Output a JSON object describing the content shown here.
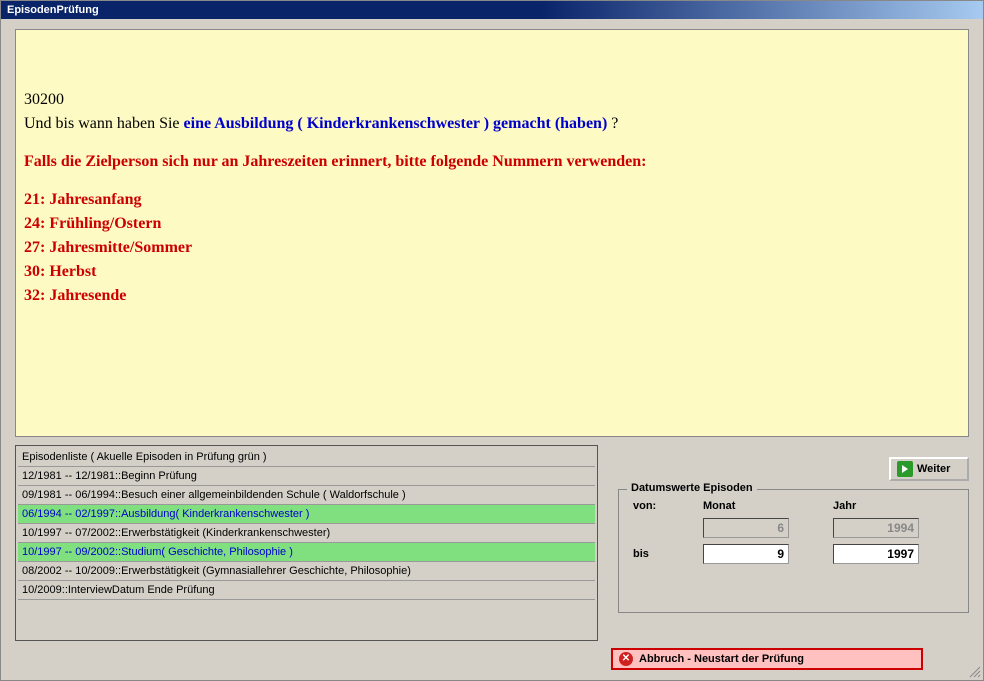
{
  "window": {
    "title": "EpisodenPrüfung"
  },
  "question": {
    "code": "30200",
    "prefix": "Und bis wann haben Sie ",
    "highlight": "eine Ausbildung ( Kinderkrankenschwester ) gemacht (haben)",
    "suffix": " ?"
  },
  "hint": {
    "intro": "Falls die Zielperson sich nur an Jahreszeiten erinnert, bitte folgende Nummern verwenden:",
    "lines": [
      "21: Jahresanfang",
      "24: Frühling/Ostern",
      "27: Jahresmitte/Sommer",
      "30: Herbst",
      "32: Jahresende"
    ]
  },
  "episodes": {
    "header": "Episodenliste ( Akuelle Episoden in Prüfung grün )",
    "items": [
      {
        "text": "12/1981 -- 12/1981::Beginn Prüfung",
        "highlight": false
      },
      {
        "text": "09/1981 -- 06/1994::Besuch einer allgemeinbildenden Schule ( Waldorfschule )",
        "highlight": false
      },
      {
        "text": "06/1994 -- 02/1997::Ausbildung( Kinderkrankenschwester )",
        "highlight": true
      },
      {
        "text": "10/1997 -- 07/2002::Erwerbstätigkeit (Kinderkrankenschwester)",
        "highlight": false
      },
      {
        "text": "10/1997 -- 09/2002::Studium( Geschichte, Philosophie )",
        "highlight": true
      },
      {
        "text": "08/2002 -- 10/2009::Erwerbstätigkeit (Gymnasiallehrer Geschichte, Philosophie)",
        "highlight": false
      },
      {
        "text": "10/2009::InterviewDatum Ende Prüfung",
        "highlight": false
      }
    ]
  },
  "dates": {
    "legend": "Datumswerte Episoden",
    "von_label": "von:",
    "bis_label": "bis",
    "month_label": "Monat",
    "year_label": "Jahr",
    "von_month": "6",
    "von_year": "1994",
    "bis_month": "9",
    "bis_year": "1997"
  },
  "buttons": {
    "weiter": "Weiter",
    "abort": "Abbruch - Neustart der Prüfung"
  }
}
